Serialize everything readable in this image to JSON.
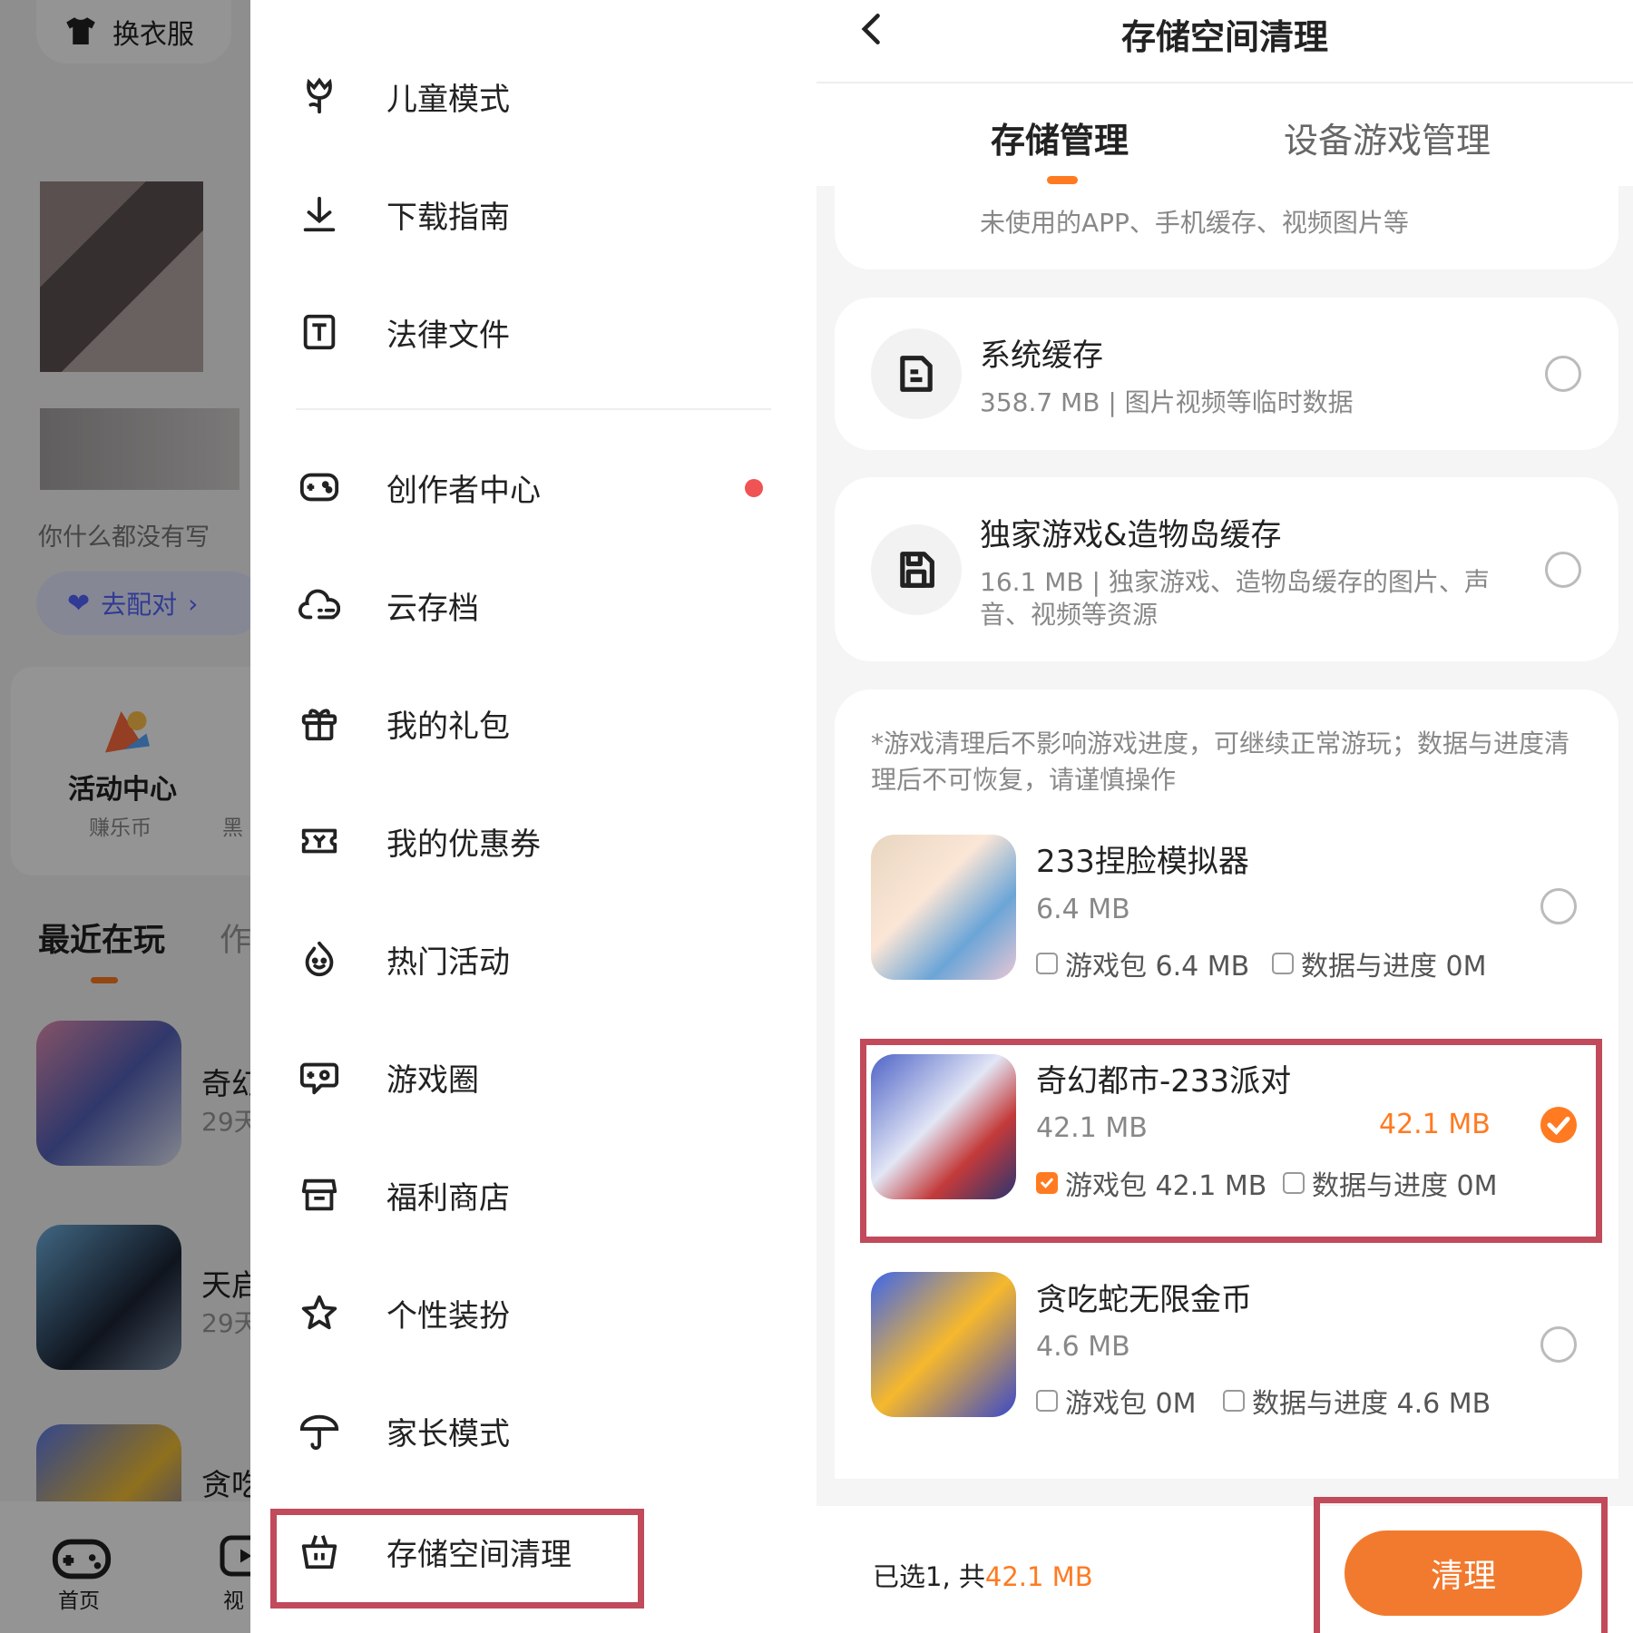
{
  "home": {
    "wardrobe_label": "换衣服",
    "signature": "你什么都没有写",
    "pair_button": "去配对",
    "activity": {
      "title": "活动中心",
      "subtitle": "赚乐币",
      "subtitle2": "黑"
    },
    "recent_tab": "最近在玩",
    "recent_tab2": "作",
    "recent_games": [
      {
        "name": "奇幻",
        "time": "29天"
      },
      {
        "name": "天启",
        "time": "29天"
      },
      {
        "name": "贪吃",
        "time": ""
      }
    ],
    "nav": {
      "home": "首页",
      "video": "视"
    }
  },
  "menu": {
    "items": [
      {
        "label": "儿童模式",
        "icon": "tulip-icon"
      },
      {
        "label": "下载指南",
        "icon": "download-icon"
      },
      {
        "label": "法律文件",
        "icon": "document-t-icon"
      },
      {
        "label": "创作者中心",
        "icon": "gamepad-icon"
      },
      {
        "label": "云存档",
        "icon": "cloud-icon"
      },
      {
        "label": "我的礼包",
        "icon": "gift-icon"
      },
      {
        "label": "我的优惠券",
        "icon": "coupon-icon"
      },
      {
        "label": "热门活动",
        "icon": "flame-face-icon"
      },
      {
        "label": "游戏圈",
        "icon": "chat-game-icon"
      },
      {
        "label": "福利商店",
        "icon": "shop-icon"
      },
      {
        "label": "个性装扮",
        "icon": "star-icon"
      },
      {
        "label": "家长模式",
        "icon": "umbrella-icon"
      },
      {
        "label": "存储空间清理",
        "icon": "basket-icon"
      }
    ]
  },
  "storage": {
    "title": "存储空间清理",
    "tabs": [
      "存储管理",
      "设备游戏管理"
    ],
    "partial_card_desc": "未使用的APP、手机缓存、视频图片等",
    "system_cache": {
      "title": "系统缓存",
      "desc": "358.7 MB | 图片视频等临时数据"
    },
    "exclusive_cache": {
      "title": "独家游戏&造物岛缓存",
      "desc": "16.1 MB | 独家游戏、造物岛缓存的图片、声音、视频等资源"
    },
    "notice": "*游戏清理后不影响游戏进度，可继续正常游玩；数据与进度清理后不可恢复，请谨慎操作",
    "games": [
      {
        "name": "233捏脸模拟器",
        "size": "6.4 MB",
        "selected_size": "",
        "opt1": "游戏包 6.4 MB",
        "opt2": "数据与进度 0M",
        "checked": false
      },
      {
        "name": "奇幻都市-233派对",
        "size": "42.1 MB",
        "selected_size": "42.1 MB",
        "opt1": "游戏包 42.1 MB",
        "opt2": "数据与进度 0M",
        "checked": true
      },
      {
        "name": "贪吃蛇无限金币",
        "size": "4.6 MB",
        "selected_size": "",
        "opt1": "游戏包 0M",
        "opt2": "数据与进度 4.6 MB",
        "checked": false
      }
    ],
    "summary_prefix": "已选1, 共",
    "summary_total": "42.1 MB",
    "clean_button": "清理"
  },
  "colors": {
    "accent": "#ff7a21",
    "highlight": "#c14a5b",
    "nav_dot": "#f05353"
  }
}
